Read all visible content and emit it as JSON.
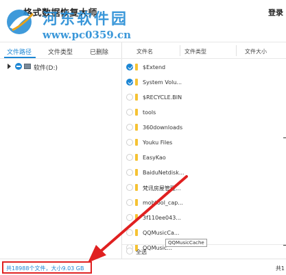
{
  "window": {
    "title": "格式数据恢复大师",
    "login": "登录"
  },
  "watermark": {
    "name": "河东软件园",
    "url": "www.pc0359.cn"
  },
  "left_tabs": [
    {
      "label": "文件路径",
      "active": true
    },
    {
      "label": "文件类型",
      "active": false
    },
    {
      "label": "已删除",
      "active": false
    }
  ],
  "tree": {
    "drive_label": "软件(D:)"
  },
  "columns": {
    "name": "文件名",
    "type": "文件类型",
    "size": "文件大小"
  },
  "files": [
    {
      "name": "$Extend",
      "checked": true
    },
    {
      "name": "System Volu...",
      "checked": true
    },
    {
      "name": "$RECYCLE.BIN",
      "checked": false
    },
    {
      "name": "tools",
      "checked": false
    },
    {
      "name": "360downloads",
      "checked": false
    },
    {
      "name": "Youku Files",
      "checked": false
    },
    {
      "name": "EasyKao",
      "checked": false
    },
    {
      "name": "BaiduNetdisk...",
      "checked": false
    },
    {
      "name": "梵讯房屋管理...",
      "checked": false
    },
    {
      "name": "mobtool_cap...",
      "checked": false
    },
    {
      "name": "3f110ee043...",
      "checked": false
    },
    {
      "name": "QQMusicCa...",
      "checked": false
    },
    {
      "name": "QQMusic...",
      "checked": false
    }
  ],
  "select_all_label": "全选",
  "tooltip": "QQMusicCache",
  "status": {
    "summary": "共18988个文件，大小9.03 GB",
    "right_text": "共1"
  },
  "colors": {
    "accent": "#1c86d4",
    "highlight": "#e02020",
    "folder": "#f5c233"
  }
}
